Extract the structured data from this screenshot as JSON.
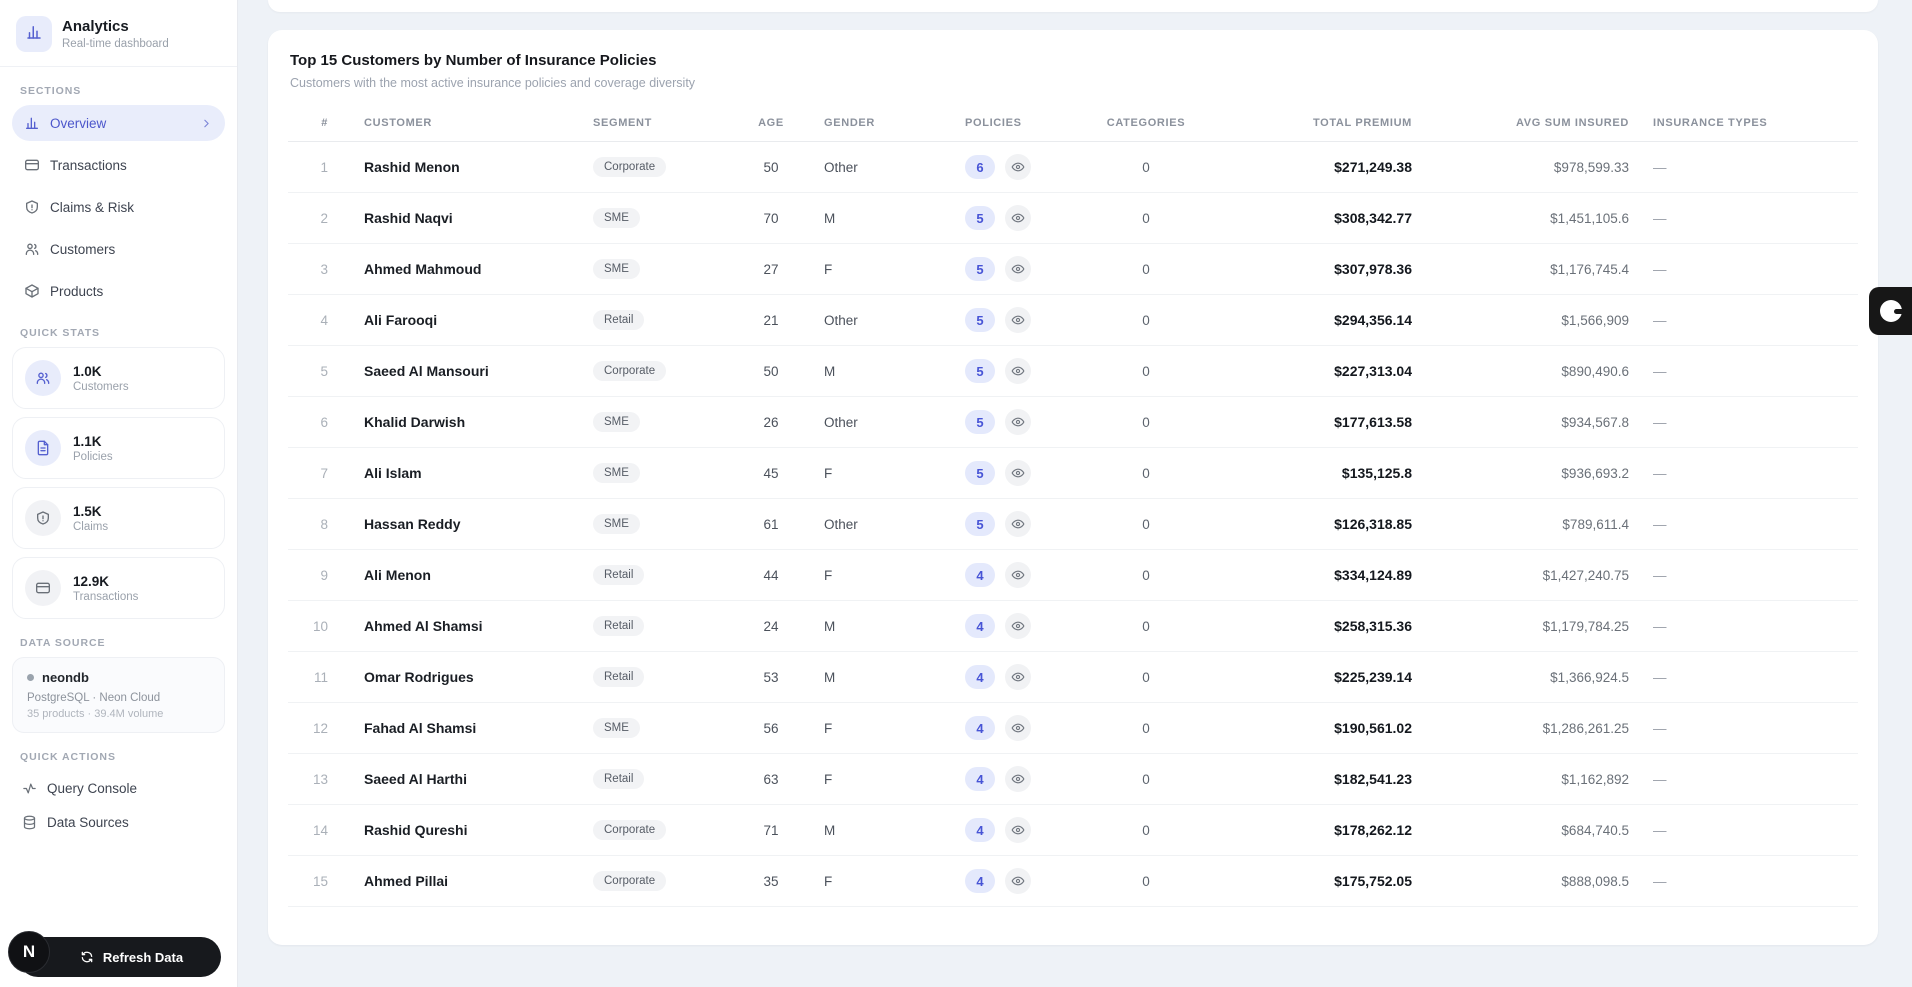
{
  "colors": {
    "accent": "#5560d0",
    "accent_bg": "#e9edfb",
    "page_bg": "#eef2f7",
    "badge_bg": "#e4e9fc",
    "badge_text": "#4754d6",
    "dark_button": "#17191d"
  },
  "sidebar": {
    "app_title": "Analytics",
    "app_subtitle": "Real-time dashboard",
    "logo_icon": "bar-chart-icon",
    "sections_label": "SECTIONS",
    "nav": [
      {
        "label": "Overview",
        "icon": "bar-chart",
        "active": true
      },
      {
        "label": "Transactions",
        "icon": "credit-card",
        "active": false
      },
      {
        "label": "Claims & Risk",
        "icon": "shield-alert",
        "active": false
      },
      {
        "label": "Customers",
        "icon": "users",
        "active": false
      },
      {
        "label": "Products",
        "icon": "package",
        "active": false
      }
    ],
    "quick_stats_label": "QUICK STATS",
    "quick_stats": [
      {
        "value": "1.0K",
        "label": "Customers",
        "icon": "users",
        "tint": "indigo"
      },
      {
        "value": "1.1K",
        "label": "Policies",
        "icon": "file-text",
        "tint": "indigo"
      },
      {
        "value": "1.5K",
        "label": "Claims",
        "icon": "shield-alert",
        "tint": "gray"
      },
      {
        "value": "12.9K",
        "label": "Transactions",
        "icon": "credit-card",
        "tint": "gray"
      }
    ],
    "data_source_label": "DATA SOURCE",
    "data_source": {
      "name": "neondb",
      "line1": "PostgreSQL · Neon Cloud",
      "line2": "35 products · 39.4M volume"
    },
    "quick_actions_label": "QUICK ACTIONS",
    "quick_actions": [
      {
        "label": "Query Console",
        "icon": "activity"
      },
      {
        "label": "Data Sources",
        "icon": "database"
      }
    ],
    "refresh_label": "Refresh Data",
    "n_badge": "N"
  },
  "main": {
    "card": {
      "title": "Top 15 Customers by Number of Insurance Policies",
      "subtitle": "Customers with the most active insurance policies and coverage diversity"
    },
    "table": {
      "columns": {
        "rank": "#",
        "customer": "CUSTOMER",
        "segment": "SEGMENT",
        "age": "AGE",
        "gender": "GENDER",
        "policies": "POLICIES",
        "categories": "CATEGORIES",
        "total_premium": "TOTAL PREMIUM",
        "avg_sum_insured": "AVG SUM INSURED",
        "insurance_types": "INSURANCE TYPES"
      },
      "rows": [
        {
          "rank": "1",
          "customer": "Rashid Menon",
          "segment": "Corporate",
          "age": "50",
          "gender": "Other",
          "policies": "6",
          "categories": "0",
          "total_premium": "$271,249.38",
          "avg_sum_insured": "$978,599.33",
          "insurance_types": "—"
        },
        {
          "rank": "2",
          "customer": "Rashid Naqvi",
          "segment": "SME",
          "age": "70",
          "gender": "M",
          "policies": "5",
          "categories": "0",
          "total_premium": "$308,342.77",
          "avg_sum_insured": "$1,451,105.6",
          "insurance_types": "—"
        },
        {
          "rank": "3",
          "customer": "Ahmed Mahmoud",
          "segment": "SME",
          "age": "27",
          "gender": "F",
          "policies": "5",
          "categories": "0",
          "total_premium": "$307,978.36",
          "avg_sum_insured": "$1,176,745.4",
          "insurance_types": "—"
        },
        {
          "rank": "4",
          "customer": "Ali Farooqi",
          "segment": "Retail",
          "age": "21",
          "gender": "Other",
          "policies": "5",
          "categories": "0",
          "total_premium": "$294,356.14",
          "avg_sum_insured": "$1,566,909",
          "insurance_types": "—"
        },
        {
          "rank": "5",
          "customer": "Saeed Al Mansouri",
          "segment": "Corporate",
          "age": "50",
          "gender": "M",
          "policies": "5",
          "categories": "0",
          "total_premium": "$227,313.04",
          "avg_sum_insured": "$890,490.6",
          "insurance_types": "—"
        },
        {
          "rank": "6",
          "customer": "Khalid Darwish",
          "segment": "SME",
          "age": "26",
          "gender": "Other",
          "policies": "5",
          "categories": "0",
          "total_premium": "$177,613.58",
          "avg_sum_insured": "$934,567.8",
          "insurance_types": "—"
        },
        {
          "rank": "7",
          "customer": "Ali Islam",
          "segment": "SME",
          "age": "45",
          "gender": "F",
          "policies": "5",
          "categories": "0",
          "total_premium": "$135,125.8",
          "avg_sum_insured": "$936,693.2",
          "insurance_types": "—"
        },
        {
          "rank": "8",
          "customer": "Hassan Reddy",
          "segment": "SME",
          "age": "61",
          "gender": "Other",
          "policies": "5",
          "categories": "0",
          "total_premium": "$126,318.85",
          "avg_sum_insured": "$789,611.4",
          "insurance_types": "—"
        },
        {
          "rank": "9",
          "customer": "Ali Menon",
          "segment": "Retail",
          "age": "44",
          "gender": "F",
          "policies": "4",
          "categories": "0",
          "total_premium": "$334,124.89",
          "avg_sum_insured": "$1,427,240.75",
          "insurance_types": "—"
        },
        {
          "rank": "10",
          "customer": "Ahmed Al Shamsi",
          "segment": "Retail",
          "age": "24",
          "gender": "M",
          "policies": "4",
          "categories": "0",
          "total_premium": "$258,315.36",
          "avg_sum_insured": "$1,179,784.25",
          "insurance_types": "—"
        },
        {
          "rank": "11",
          "customer": "Omar Rodrigues",
          "segment": "Retail",
          "age": "53",
          "gender": "M",
          "policies": "4",
          "categories": "0",
          "total_premium": "$225,239.14",
          "avg_sum_insured": "$1,366,924.5",
          "insurance_types": "—"
        },
        {
          "rank": "12",
          "customer": "Fahad Al Shamsi",
          "segment": "SME",
          "age": "56",
          "gender": "F",
          "policies": "4",
          "categories": "0",
          "total_premium": "$190,561.02",
          "avg_sum_insured": "$1,286,261.25",
          "insurance_types": "—"
        },
        {
          "rank": "13",
          "customer": "Saeed Al Harthi",
          "segment": "Retail",
          "age": "63",
          "gender": "F",
          "policies": "4",
          "categories": "0",
          "total_premium": "$182,541.23",
          "avg_sum_insured": "$1,162,892",
          "insurance_types": "—"
        },
        {
          "rank": "14",
          "customer": "Rashid Qureshi",
          "segment": "Corporate",
          "age": "71",
          "gender": "M",
          "policies": "4",
          "categories": "0",
          "total_premium": "$178,262.12",
          "avg_sum_insured": "$684,740.5",
          "insurance_types": "—"
        },
        {
          "rank": "15",
          "customer": "Ahmed Pillai",
          "segment": "Corporate",
          "age": "35",
          "gender": "F",
          "policies": "4",
          "categories": "0",
          "total_premium": "$175,752.05",
          "avg_sum_insured": "$888,098.5",
          "insurance_types": "—"
        }
      ]
    }
  },
  "floating_tab": {
    "icon": "circle-glyph"
  }
}
